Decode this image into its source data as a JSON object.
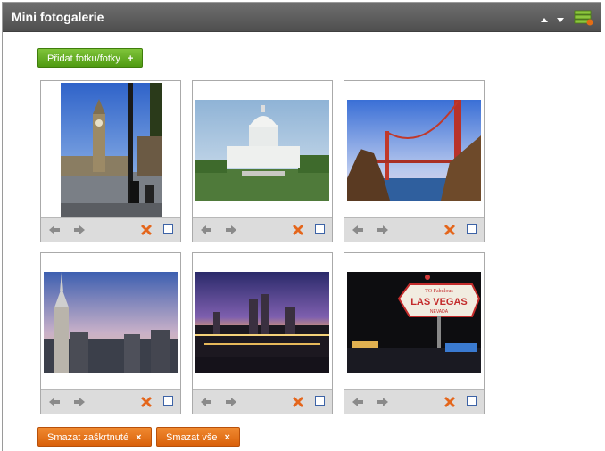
{
  "window": {
    "title": "Mini fotogalerie"
  },
  "header": {
    "collapse_icon": "triangle-up-icon",
    "expand_icon": "triangle-down-icon",
    "menu_icon": "layers-menu-icon"
  },
  "toolbar": {
    "add_label": "Přidat fotku/fotky",
    "add_symbol": "+"
  },
  "photos": [
    {
      "subject": "big-ben"
    },
    {
      "subject": "us-capitol"
    },
    {
      "subject": "golden-gate-bridge"
    },
    {
      "subject": "chrysler-building"
    },
    {
      "subject": "city-skyline-night"
    },
    {
      "subject": "las-vegas-sign",
      "sign_top": "TO Fabulous",
      "sign_main": "LAS VEGAS",
      "sign_bottom": "NEVADA"
    }
  ],
  "footer": {
    "delete_checked_label": "Smazat zaškrtnuté",
    "delete_all_label": "Smazat vše",
    "close_symbol": "×"
  },
  "colors": {
    "header": "#5a5a5a",
    "green": "#5ba71b",
    "orange": "#e46d14",
    "delete_x": "#e4661c"
  }
}
